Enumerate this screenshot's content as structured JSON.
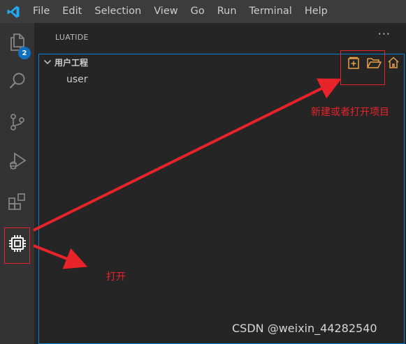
{
  "menu": {
    "items": [
      "File",
      "Edit",
      "Selection",
      "View",
      "Go",
      "Run",
      "Terminal",
      "Help"
    ]
  },
  "activity_bar": {
    "items": [
      {
        "icon": "explorer-icon",
        "badge": "2"
      },
      {
        "icon": "search-icon"
      },
      {
        "icon": "source-control-icon"
      },
      {
        "icon": "run-debug-icon"
      },
      {
        "icon": "extensions-icon"
      },
      {
        "icon": "chip-icon",
        "active": true
      }
    ]
  },
  "sidebar": {
    "title": "LUATIDE",
    "more": "···",
    "section": {
      "title": "用户工程",
      "actions": [
        "new-project-icon",
        "open-folder-icon",
        "home-icon"
      ],
      "items": [
        "user"
      ]
    }
  },
  "annotations": {
    "label_new_open": "新建或者打开项目",
    "label_open": "打开",
    "color": "#e8232a"
  },
  "watermark": "CSDN @weixin_44282540",
  "colors": {
    "titlebar": "#3c3c3c",
    "activitybar": "#333333",
    "sidebar": "#252526",
    "focus_border": "#007fd4",
    "vscode_blue": "#23a9f2",
    "action_orange": "#e8a245"
  }
}
